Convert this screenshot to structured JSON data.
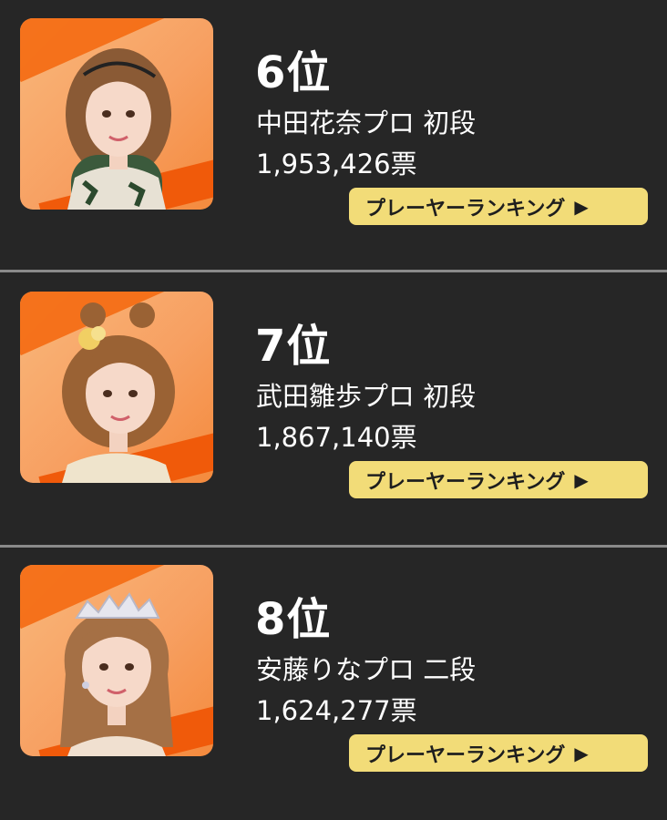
{
  "entries": [
    {
      "rank": "6位",
      "name": "中田花奈プロ 初段",
      "votes": "1,953,426票",
      "button_label": "プレーヤーランキング",
      "hair_color": "#8a5a35"
    },
    {
      "rank": "7位",
      "name": "武田雛歩プロ 初段",
      "votes": "1,867,140票",
      "button_label": "プレーヤーランキング",
      "hair_color": "#9a6234"
    },
    {
      "rank": "8位",
      "name": "安藤りなプロ 二段",
      "votes": "1,624,277票",
      "button_label": "プレーヤーランキング",
      "hair_color": "#a57045"
    }
  ],
  "button_arrow": "▶",
  "colors": {
    "background": "#262626",
    "button": "#f2dc78",
    "accent_orange": "#f46a12"
  },
  "icons": {
    "arrow": "play-arrow-icon"
  }
}
